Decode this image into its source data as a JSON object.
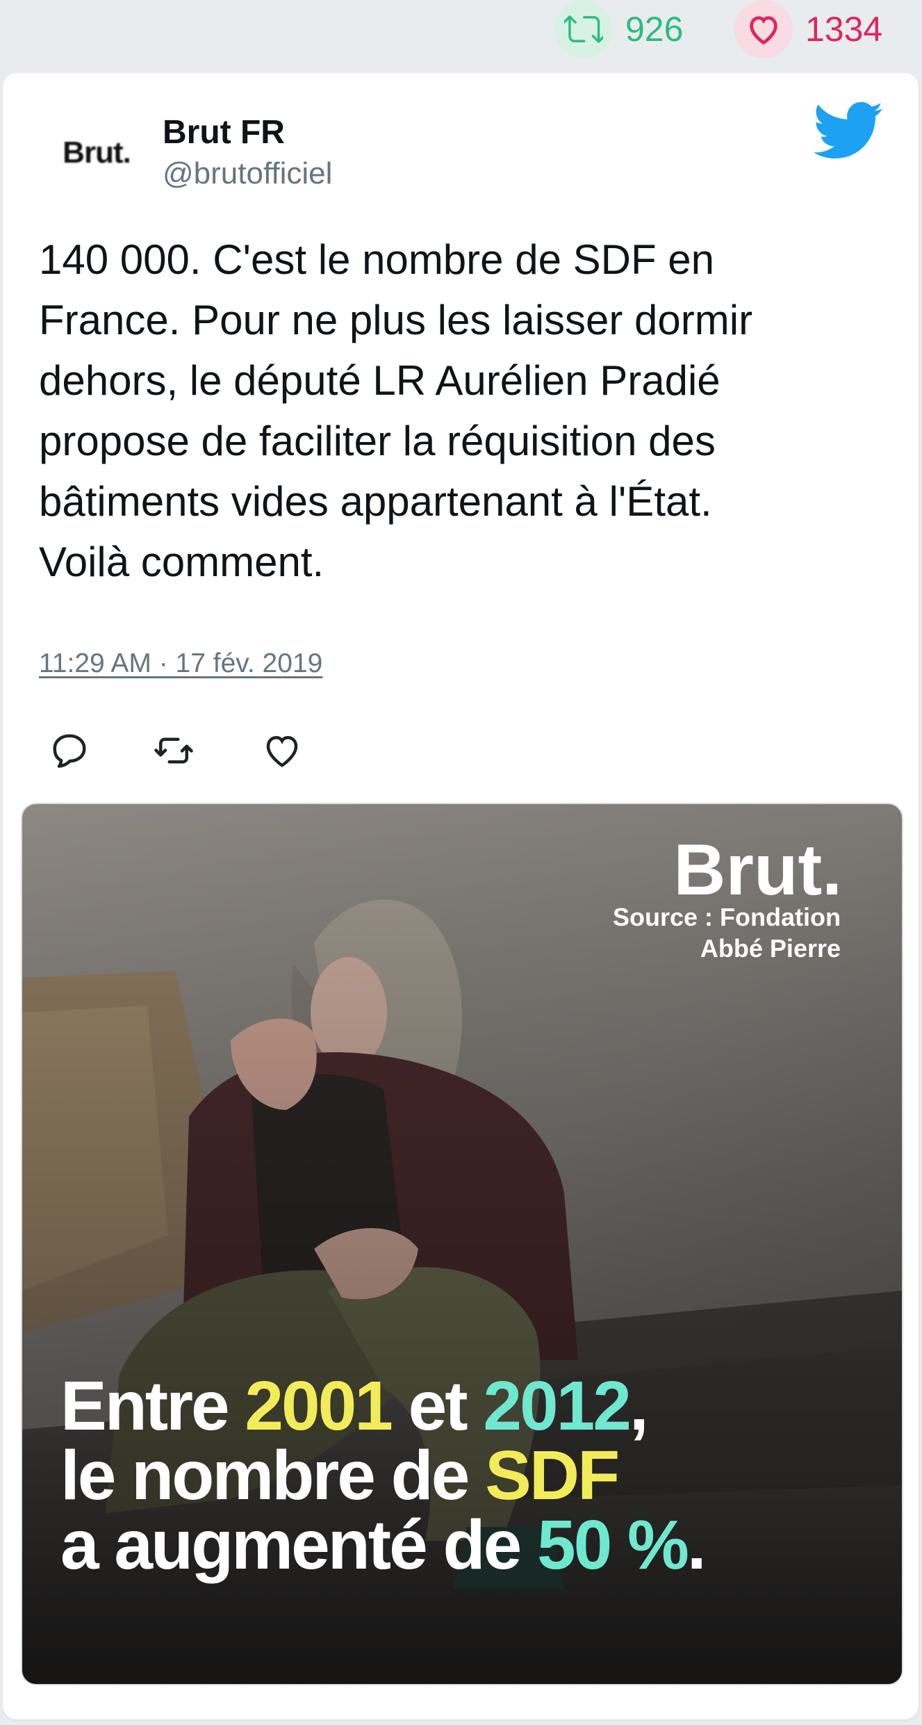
{
  "stats": {
    "retweets": "926",
    "likes": "1334",
    "retweet_color": "#2bbd7e",
    "like_color": "#e0245e"
  },
  "tweet": {
    "avatar_logo_text": "Brut.",
    "display_name": "Brut FR",
    "handle": "@brutofficiel",
    "text": "140 000. C'est le nombre de SDF en\nFrance. Pour ne plus les laisser dormir\ndehors, le député LR Aurélien Pradié\npropose de faciliter la réquisition des\nbâtiments vides appartenant à l'État.\nVoilà comment.",
    "timestamp": "11:29 AM · 17 fév. 2019"
  },
  "media": {
    "logo": "Brut.",
    "source_line1": "Source : Fondation",
    "source_line2": "Abbé Pierre",
    "caption": {
      "l1_a": "Entre ",
      "l1_b": "2001",
      "l1_c": " et ",
      "l1_d": "2012",
      "l1_e": ",",
      "l2_a": "le nombre de ",
      "l2_b": "SDF",
      "l3_a": "a augmenté de ",
      "l3_b": "50 %",
      "l3_c": "."
    },
    "highlight_yellow": "#f3ec5a",
    "highlight_teal": "#6ee8cf"
  },
  "icons": {
    "retweet": "retweet-icon",
    "like": "heart-icon",
    "reply": "reply-icon",
    "brand": "twitter-bird-icon"
  }
}
